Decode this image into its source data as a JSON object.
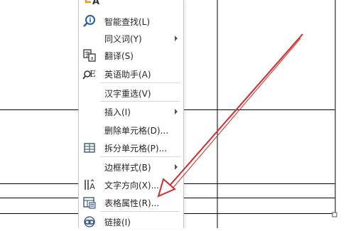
{
  "menu": {
    "top_glyph_label": "A",
    "items": [
      {
        "label": "智能查找(L)",
        "icon": "search-info-icon",
        "submenu": false
      },
      {
        "label": "同义词(Y)",
        "icon": "",
        "submenu": true
      },
      {
        "label": "翻译(S)",
        "icon": "translate-icon",
        "submenu": false
      },
      {
        "label": "英语助手(A)",
        "icon": "english-assistant-icon",
        "submenu": false
      },
      {
        "label": "汉字重选(V)",
        "icon": "",
        "submenu": false
      },
      {
        "label": "插入(I)",
        "icon": "",
        "submenu": true
      },
      {
        "label": "删除单元格(D)...",
        "icon": "",
        "submenu": false
      },
      {
        "label": "拆分单元格(P)...",
        "icon": "split-cells-icon",
        "submenu": false
      },
      {
        "label": "边框样式(B)",
        "icon": "",
        "submenu": true
      },
      {
        "label": "文字方向(X)...",
        "icon": "text-direction-icon",
        "submenu": false
      },
      {
        "label": "表格属性(R)...",
        "icon": "table-properties-icon",
        "submenu": false
      },
      {
        "label": "链接(I)",
        "icon": "link-icon",
        "submenu": false
      }
    ]
  },
  "colors": {
    "annotation_arrow": "#d42a2a",
    "table_lines": "#000000",
    "menu_border": "#c6c6c6"
  }
}
